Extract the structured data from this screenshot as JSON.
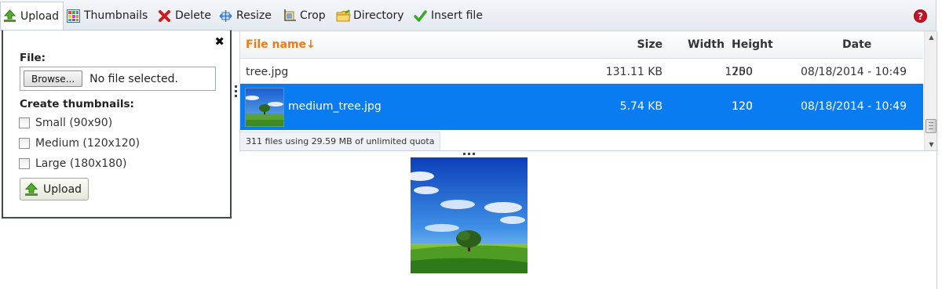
{
  "toolbar": {
    "upload": "Upload",
    "thumbnails": "Thumbnails",
    "delete": "Delete",
    "resize": "Resize",
    "crop": "Crop",
    "directory": "Directory",
    "insert_file": "Insert file",
    "help": "?"
  },
  "upload_panel": {
    "file_label": "File:",
    "browse_label": "Browse...",
    "no_file_text": "No file selected.",
    "thumbnails_label": "Create thumbnails:",
    "options": [
      {
        "label": "Small (90x90)",
        "checked": false
      },
      {
        "label": "Medium (120x120)",
        "checked": false
      },
      {
        "label": "Large (180x180)",
        "checked": false
      }
    ],
    "upload_button": "Upload",
    "close_glyph": "✖"
  },
  "file_list": {
    "columns": {
      "name": "File name↓",
      "size": "Size",
      "width": "Width",
      "height": "Height",
      "date": "Date"
    },
    "rows": [
      {
        "name": "tree.jpg",
        "size": "131.11 KB",
        "width": "1200",
        "height": "750",
        "date": "08/18/2014 - 10:49",
        "selected": false
      },
      {
        "name": "medium_tree.jpg",
        "size": "5.74 KB",
        "width": "120",
        "height": "120",
        "date": "08/18/2014 - 10:49",
        "selected": true
      }
    ],
    "quota": {
      "files_text": "311 files using ",
      "used": "29.59 MB",
      "of_text": " of ",
      "limit": "unlimited quota"
    }
  },
  "colors": {
    "selected_row": "#0a7cf2",
    "sorted_column": "#f07a14",
    "help_icon": "#cc1122"
  },
  "icons": {
    "upload": "upload-arrow-icon",
    "thumbnails": "thumbnails-grid-icon",
    "delete": "delete-x-icon",
    "resize": "resize-icon",
    "crop": "crop-icon",
    "directory": "folder-icon",
    "insert_file": "checkmark-icon",
    "help": "help-icon"
  }
}
